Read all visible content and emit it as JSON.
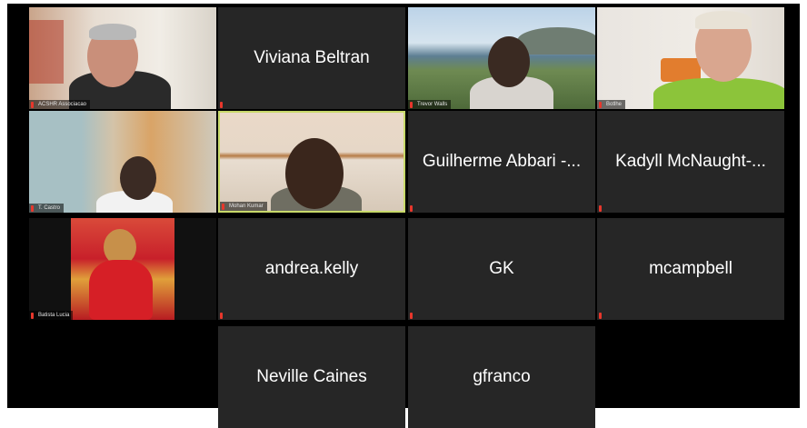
{
  "meeting": {
    "video_tiles": [
      {
        "label": "ACSHR Associacao"
      },
      {
        "label": "Trevor Walls"
      },
      {
        "label": "Botlhe"
      },
      {
        "label": "T. Castro"
      },
      {
        "label": "Mohan Kumar"
      },
      {
        "label": "Batista Lucia"
      }
    ],
    "name_tiles": [
      {
        "name": "Viviana Beltran"
      },
      {
        "name": "Guilherme Abbari -..."
      },
      {
        "name": "Kadyll McNaught-..."
      },
      {
        "name": "andrea.kelly"
      },
      {
        "name": "GK"
      },
      {
        "name": "mcampbell"
      },
      {
        "name": "Neville Caines"
      },
      {
        "name": "gfranco"
      }
    ]
  },
  "colors": {
    "tile_bg": "#262626",
    "active_speaker_border": "#c8d96a",
    "muted_mic": "#e8372c"
  },
  "icons": {
    "muted": "mic-muted-icon"
  }
}
